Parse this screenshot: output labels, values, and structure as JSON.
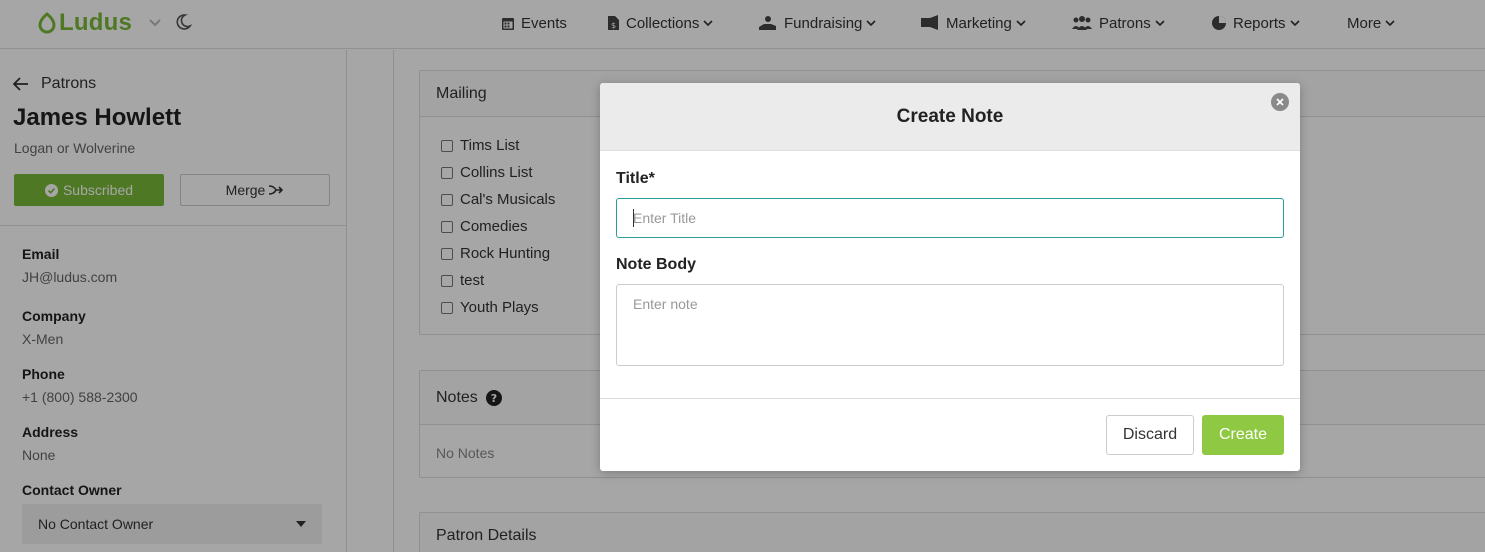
{
  "brand": {
    "name": "Ludus",
    "accent": "#7ab83a"
  },
  "nav": {
    "items": [
      {
        "label": "Events",
        "icon": "calendar-icon"
      },
      {
        "label": "Collections",
        "icon": "document-dollar-icon"
      },
      {
        "label": "Fundraising",
        "icon": "hand-donate-icon"
      },
      {
        "label": "Marketing",
        "icon": "megaphone-icon"
      },
      {
        "label": "Patrons",
        "icon": "users-icon"
      },
      {
        "label": "Reports",
        "icon": "pie-chart-icon"
      },
      {
        "label": "More",
        "icon": ""
      }
    ]
  },
  "sidebar": {
    "back_label": "Patrons",
    "patron_name": "James Howlett",
    "patron_alias": "Logan or Wolverine",
    "subscribed_label": "Subscribed",
    "merge_label": "Merge",
    "fields": {
      "email_label": "Email",
      "email_value": "JH@ludus.com",
      "company_label": "Company",
      "company_value": "X-Men",
      "phone_label": "Phone",
      "phone_value": "+1 (800) 588-2300",
      "address_label": "Address",
      "address_value": "None",
      "owner_label": "Contact Owner",
      "owner_value": "No Contact Owner"
    }
  },
  "main": {
    "mailing": {
      "title": "Mailing",
      "lists": [
        "Tims List",
        "Collins List",
        "Cal's Musicals",
        "Comedies",
        "Rock Hunting",
        "test",
        "Youth Plays"
      ]
    },
    "notes": {
      "title": "Notes",
      "empty_text": "No Notes"
    },
    "patron_details": {
      "title": "Patron Details"
    }
  },
  "modal": {
    "title": "Create Note",
    "title_label": "Title*",
    "title_placeholder": "Enter Title",
    "body_label": "Note Body",
    "body_placeholder": "Enter note",
    "discard_label": "Discard",
    "create_label": "Create"
  }
}
